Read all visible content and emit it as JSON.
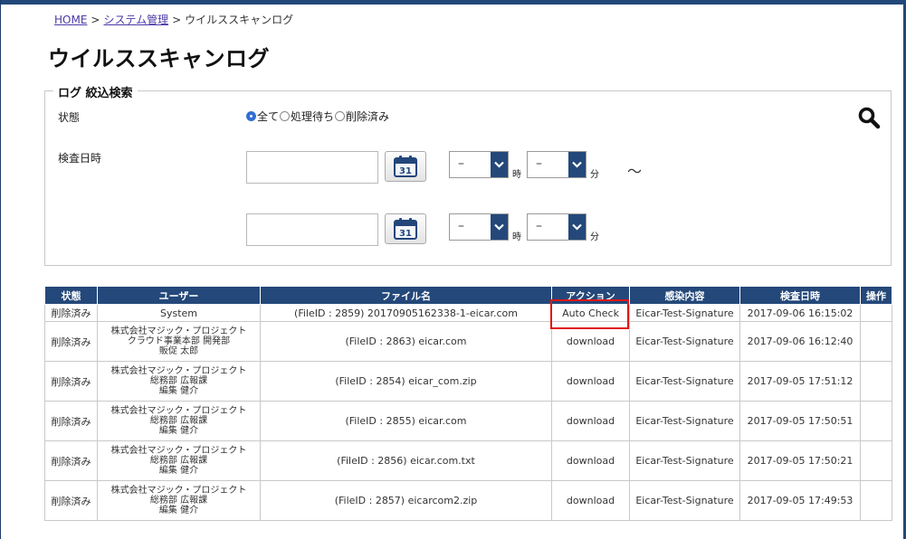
{
  "breadcrumb": {
    "home": "HOME",
    "separator": ">",
    "system": "システム管理",
    "current": "ウイルススキャンログ"
  },
  "page": {
    "title": "ウイルススキャンログ"
  },
  "filter": {
    "legend": "ログ 絞込検索",
    "status_label": "状態",
    "status_options": [
      {
        "label": "全て",
        "selected": true
      },
      {
        "label": "処理待ち",
        "selected": false
      },
      {
        "label": "削除済み",
        "selected": false
      }
    ],
    "date_label": "検査日時",
    "search_icon": "search-icon",
    "calendar_icon": "calendar-icon",
    "calendar_day": "31",
    "from": {
      "date": "",
      "hour": "–",
      "minute": "–"
    },
    "to": {
      "date": "",
      "hour": "–",
      "minute": "–"
    },
    "hour_unit": "時",
    "minute_unit": "分",
    "range_separator": "〜"
  },
  "table": {
    "headers": [
      "状態",
      "ユーザー",
      "ファイル名",
      "アクション",
      "感染内容",
      "検査日時",
      "操作"
    ],
    "rows": [
      {
        "status": "削除済み",
        "user": [
          "System"
        ],
        "file": "(FileID : 2859) 20170905162338-1-eicar.com",
        "action": "Auto Check",
        "infection": "Eicar-Test-Signature",
        "date": "2017-09-06 16:15:02"
      },
      {
        "status": "削除済み",
        "user": [
          "株式会社マジック・プロジェクト",
          "クラウド事業本部 開発部",
          "販促 太郎"
        ],
        "file": "(FileID : 2863) eicar.com",
        "action": "download",
        "infection": "Eicar-Test-Signature",
        "date": "2017-09-06 16:12:40"
      },
      {
        "status": "削除済み",
        "user": [
          "株式会社マジック・プロジェクト",
          "総務部 広報課",
          "編集 健介"
        ],
        "file": "(FileID : 2854) eicar_com.zip",
        "action": "download",
        "infection": "Eicar-Test-Signature",
        "date": "2017-09-05 17:51:12"
      },
      {
        "status": "削除済み",
        "user": [
          "株式会社マジック・プロジェクト",
          "総務部 広報課",
          "編集 健介"
        ],
        "file": "(FileID : 2855) eicar.com",
        "action": "download",
        "infection": "Eicar-Test-Signature",
        "date": "2017-09-05 17:50:51"
      },
      {
        "status": "削除済み",
        "user": [
          "株式会社マジック・プロジェクト",
          "総務部 広報課",
          "編集 健介"
        ],
        "file": "(FileID : 2856) eicar.com.txt",
        "action": "download",
        "infection": "Eicar-Test-Signature",
        "date": "2017-09-05 17:50:21"
      },
      {
        "status": "削除済み",
        "user": [
          "株式会社マジック・プロジェクト",
          "総務部 広報課",
          "編集 健介"
        ],
        "file": "(FileID : 2857) eicarcom2.zip",
        "action": "download",
        "infection": "Eicar-Test-Signature",
        "date": "2017-09-05 17:49:53"
      }
    ]
  },
  "colors": {
    "header_bg": "#24487a",
    "highlight": "#e01515",
    "link": "#4b3aa8"
  }
}
